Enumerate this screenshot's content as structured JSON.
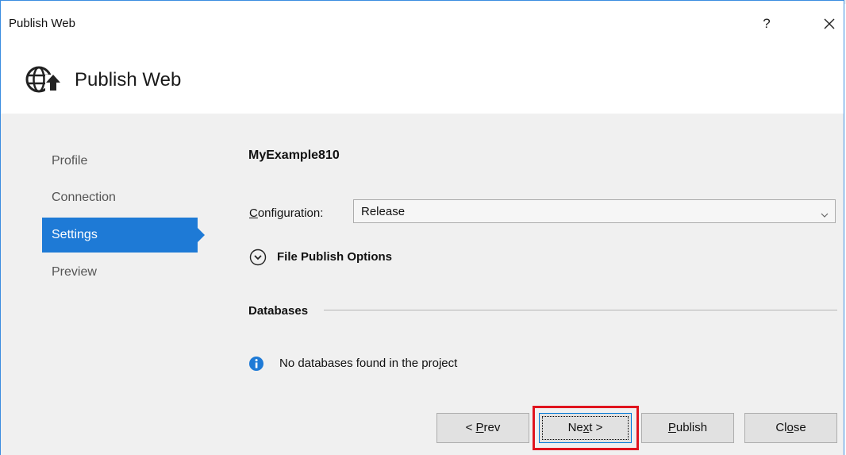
{
  "window": {
    "title": "Publish Web",
    "help_label": "?"
  },
  "header": {
    "title": "Publish Web"
  },
  "nav": {
    "items": [
      {
        "label": "Profile",
        "active": false
      },
      {
        "label": "Connection",
        "active": false
      },
      {
        "label": "Settings",
        "active": true
      },
      {
        "label": "Preview",
        "active": false
      }
    ]
  },
  "settings": {
    "profile_name": "MyExample810",
    "configuration_label_prefix": "C",
    "configuration_label_rest": "onfiguration:",
    "configuration_value": "Release",
    "file_publish_options_label": "File Publish Options",
    "databases_title": "Databases",
    "no_databases_text": "No databases found in the project"
  },
  "buttons": {
    "prev": {
      "before": "< ",
      "mnemonic": "P",
      "after": "rev"
    },
    "next": {
      "before": "Ne",
      "mnemonic": "x",
      "after": "t >"
    },
    "publish": {
      "before": "",
      "mnemonic": "P",
      "after": "ublish"
    },
    "close": {
      "before": "Cl",
      "mnemonic": "o",
      "after": "se"
    }
  },
  "colors": {
    "accent": "#1e7ad6",
    "highlight": "#e0141e",
    "info": "#1e7ad6",
    "window_border": "#3c8de0"
  }
}
